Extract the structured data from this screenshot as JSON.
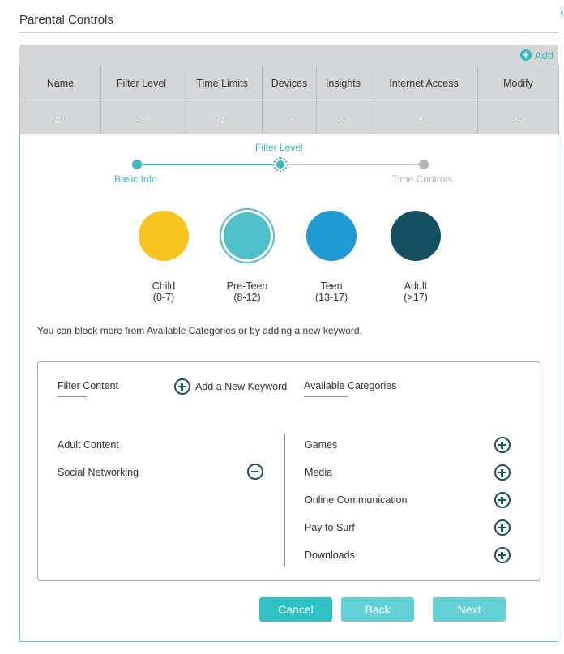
{
  "page": {
    "title": "Parental Controls"
  },
  "table": {
    "add_label": "Add",
    "columns": [
      "Name",
      "Filter Level",
      "Time Limits",
      "Devices",
      "Insights",
      "Internet Access",
      "Modify"
    ],
    "rows": [
      [
        "--",
        "--",
        "--",
        "--",
        "--",
        "--",
        "--"
      ]
    ]
  },
  "stepper": {
    "steps": [
      {
        "label": "Basic Info",
        "state": "done"
      },
      {
        "label": "Filter Level",
        "state": "current"
      },
      {
        "label": "Time Controls",
        "state": "pending"
      }
    ]
  },
  "levels": [
    {
      "name": "Child",
      "age": "(0-7)",
      "color": "#f5c41f",
      "selected": false
    },
    {
      "name": "Pre-Teen",
      "age": "(8-12)",
      "color": "#4fc0ca",
      "selected": true
    },
    {
      "name": "Teen",
      "age": "(13-17)",
      "color": "#1f9ad2",
      "selected": false
    },
    {
      "name": "Adult",
      "age": "(>17)",
      "color": "#145062",
      "selected": false
    }
  ],
  "hint": "You can block more from Available Categories or by adding a new keyword.",
  "filter": {
    "filter_content_label": "Filter Content",
    "add_keyword_label": "Add a New Keyword",
    "available_label": "Available Categories",
    "blocked": [
      "Adult Content",
      "Social Networking"
    ],
    "available": [
      "Games",
      "Media",
      "Online Communication",
      "Pay to Surf",
      "Downloads"
    ]
  },
  "buttons": {
    "cancel": "Cancel",
    "back": "Back",
    "next": "Next"
  },
  "colors": {
    "accent": "#3fb8c4",
    "icon_dark": "#1a5064"
  }
}
